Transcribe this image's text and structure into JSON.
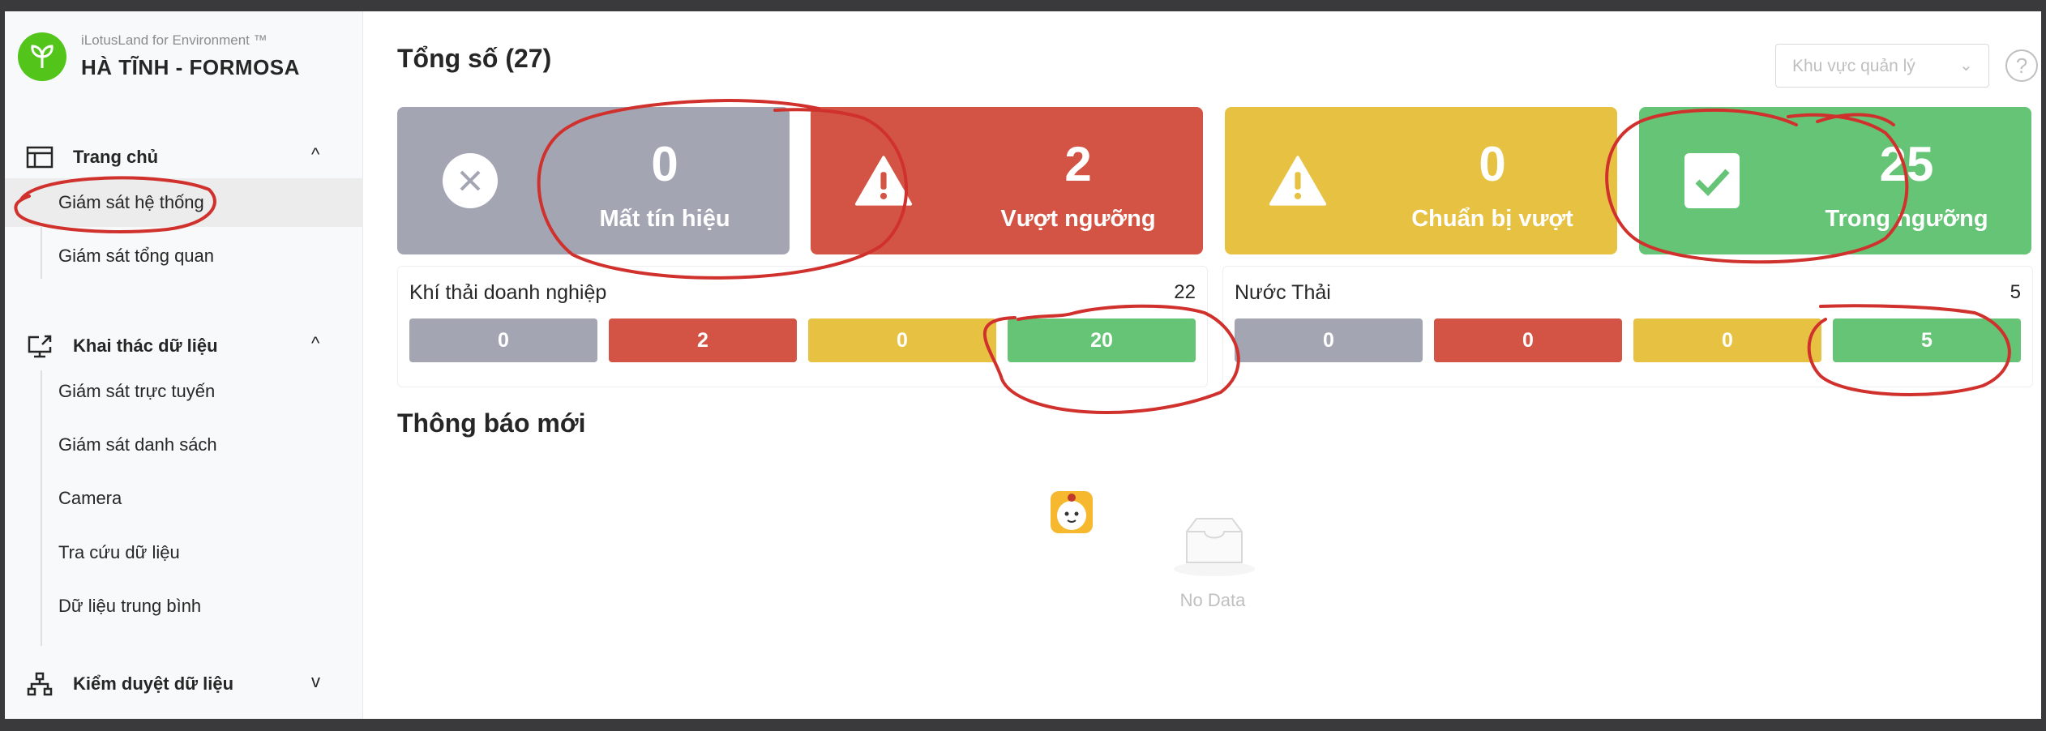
{
  "brand": {
    "subtitle": "iLotusLand for Environment ™",
    "title": "HÀ TĨNH - FORMOSA"
  },
  "sidebar": {
    "groups": [
      {
        "label": "Trang chủ",
        "icon": "layout-icon",
        "chevron": "^",
        "items": [
          {
            "label": "Giám sát hệ thống",
            "active": true
          },
          {
            "label": "Giám sát tổng quan"
          }
        ]
      },
      {
        "label": "Khai thác dữ liệu",
        "icon": "monitor-share-icon",
        "chevron": "^",
        "items": [
          {
            "label": "Giám sát trực tuyến"
          },
          {
            "label": "Giám sát danh sách"
          },
          {
            "label": "Camera"
          },
          {
            "label": "Tra cứu dữ liệu"
          },
          {
            "label": "Dữ liệu trung bình"
          }
        ]
      },
      {
        "label": "Kiểm duyệt dữ liệu",
        "icon": "sitemap-icon",
        "chevron": "v",
        "items": []
      }
    ]
  },
  "main": {
    "total_title": "Tổng số (27)",
    "region_placeholder": "Khu vực quản lý",
    "help": "?",
    "stats": [
      {
        "value": "0",
        "label": "Mất tín hiệu",
        "color": "#a3a5b3",
        "icon": "close-circle-icon"
      },
      {
        "value": "2",
        "label": "Vượt ngưỡng",
        "color": "#d35445",
        "icon": "warning-icon"
      },
      {
        "value": "0",
        "label": "Chuẩn bị vượt",
        "color": "#e7c242",
        "icon": "warning-icon"
      },
      {
        "value": "25",
        "label": "Trong ngưỡng",
        "color": "#66c476",
        "icon": "check-square-icon"
      }
    ],
    "groups": [
      {
        "name": "Khí thải doanh nghiệp",
        "count": "22",
        "values": [
          "0",
          "2",
          "0",
          "20"
        ]
      },
      {
        "name": "Nước Thải",
        "count": "5",
        "values": [
          "0",
          "0",
          "0",
          "5"
        ]
      }
    ],
    "notice_title": "Thông báo mới",
    "empty_text": "No Data"
  },
  "colors": {
    "lost": "#a3a5b3",
    "exceeded": "#d35445",
    "warning": "#e7c242",
    "good": "#66c476",
    "annotation": "#d0312d"
  }
}
